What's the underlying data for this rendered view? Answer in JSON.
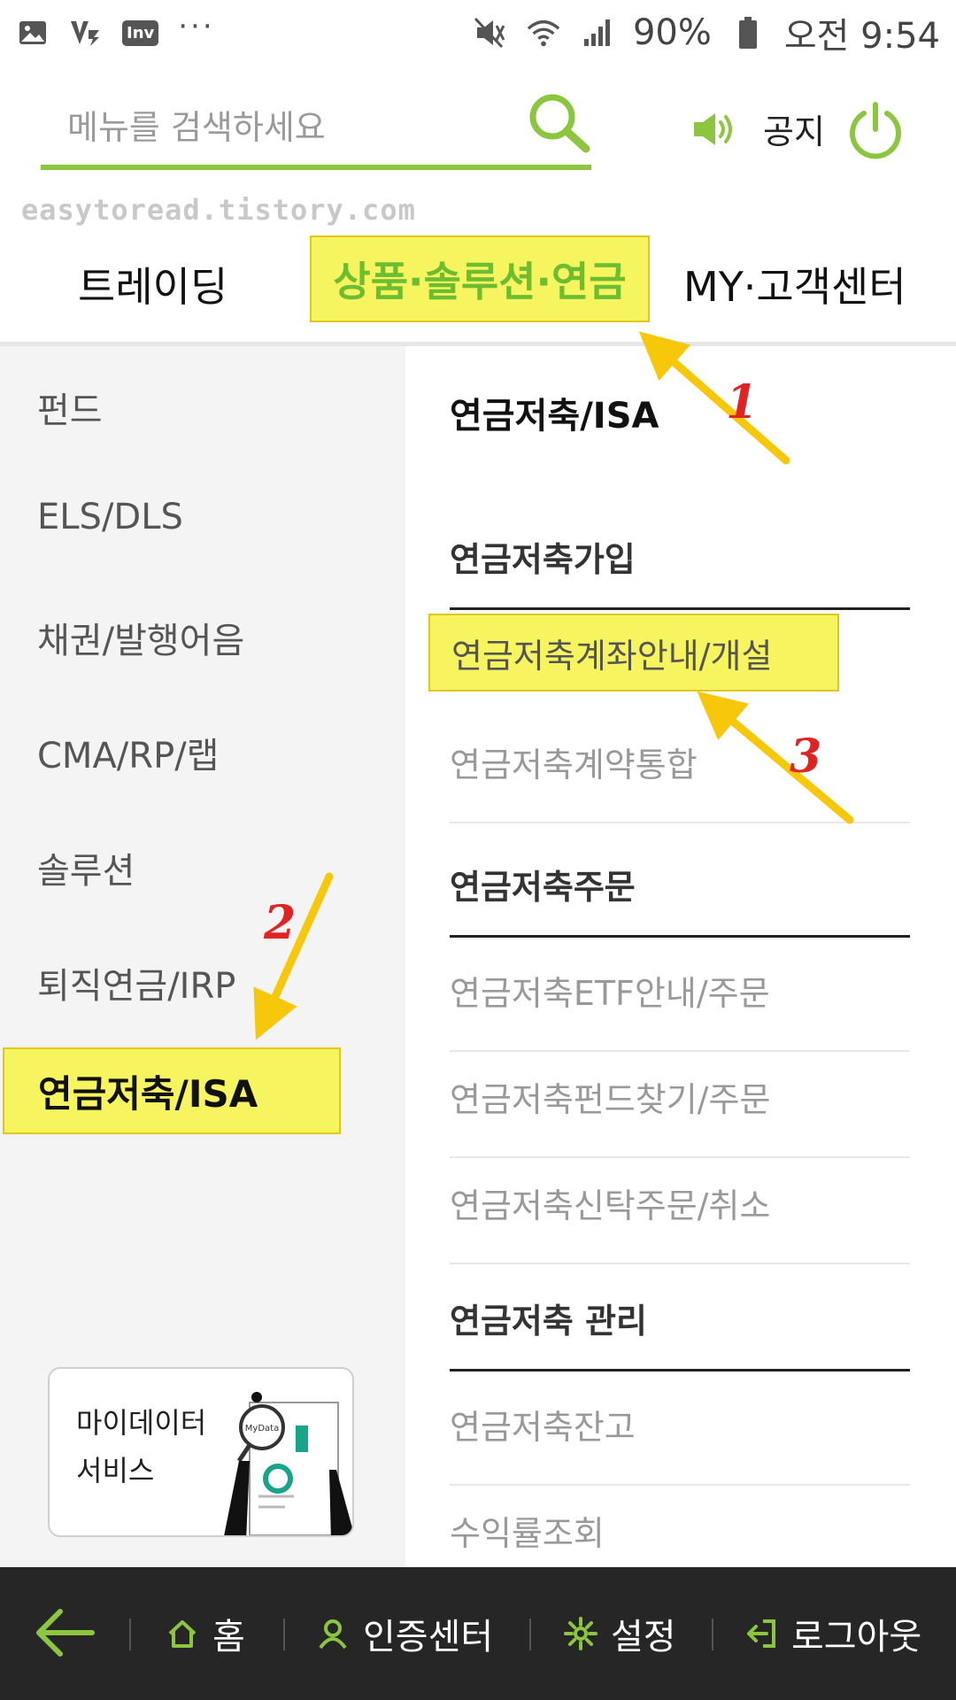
{
  "status_bar": {
    "inv_label": "Inv",
    "battery": "90%",
    "time": "오전 9:54"
  },
  "header": {
    "search_placeholder": "메뉴를 검색하세요",
    "notice_label": "공지"
  },
  "watermark": "easytoread.tistory.com",
  "tabs": [
    "트레이딩",
    "상품·솔루션·연금",
    "MY·고객센터"
  ],
  "left_nav": {
    "items": [
      "펀드",
      "ELS/DLS",
      "채권/발행어음",
      "CMA/RP/랩",
      "솔루션",
      "퇴직연금/IRP",
      "연금저축/ISA"
    ]
  },
  "mydata_card": {
    "line1": "마이데이터",
    "line2": "서비스",
    "badge": "MyData"
  },
  "right": {
    "title": "연금저축/ISA",
    "sections": [
      {
        "title": "연금저축가입",
        "links": [
          "연금저축계좌안내/개설",
          "연금저축계약통합"
        ]
      },
      {
        "title": "연금저축주문",
        "links": [
          "연금저축ETF안내/주문",
          "연금저축펀드찾기/주문",
          "연금저축신탁주문/취소"
        ]
      },
      {
        "title": "연금저축 관리",
        "links": [
          "연금저축잔고",
          "수익률조회"
        ]
      }
    ]
  },
  "annotations": [
    "1",
    "2",
    "3"
  ],
  "bottom_bar": {
    "home": "홈",
    "cert": "인증센터",
    "settings": "설정",
    "logout": "로그아웃"
  },
  "colors": {
    "accent_green": "#8cc63f",
    "highlight_yellow": "#f6f45f",
    "arrow_yellow": "#f7c80a",
    "annotation_red": "#e02424",
    "bottom_bar_bg": "#262626"
  }
}
